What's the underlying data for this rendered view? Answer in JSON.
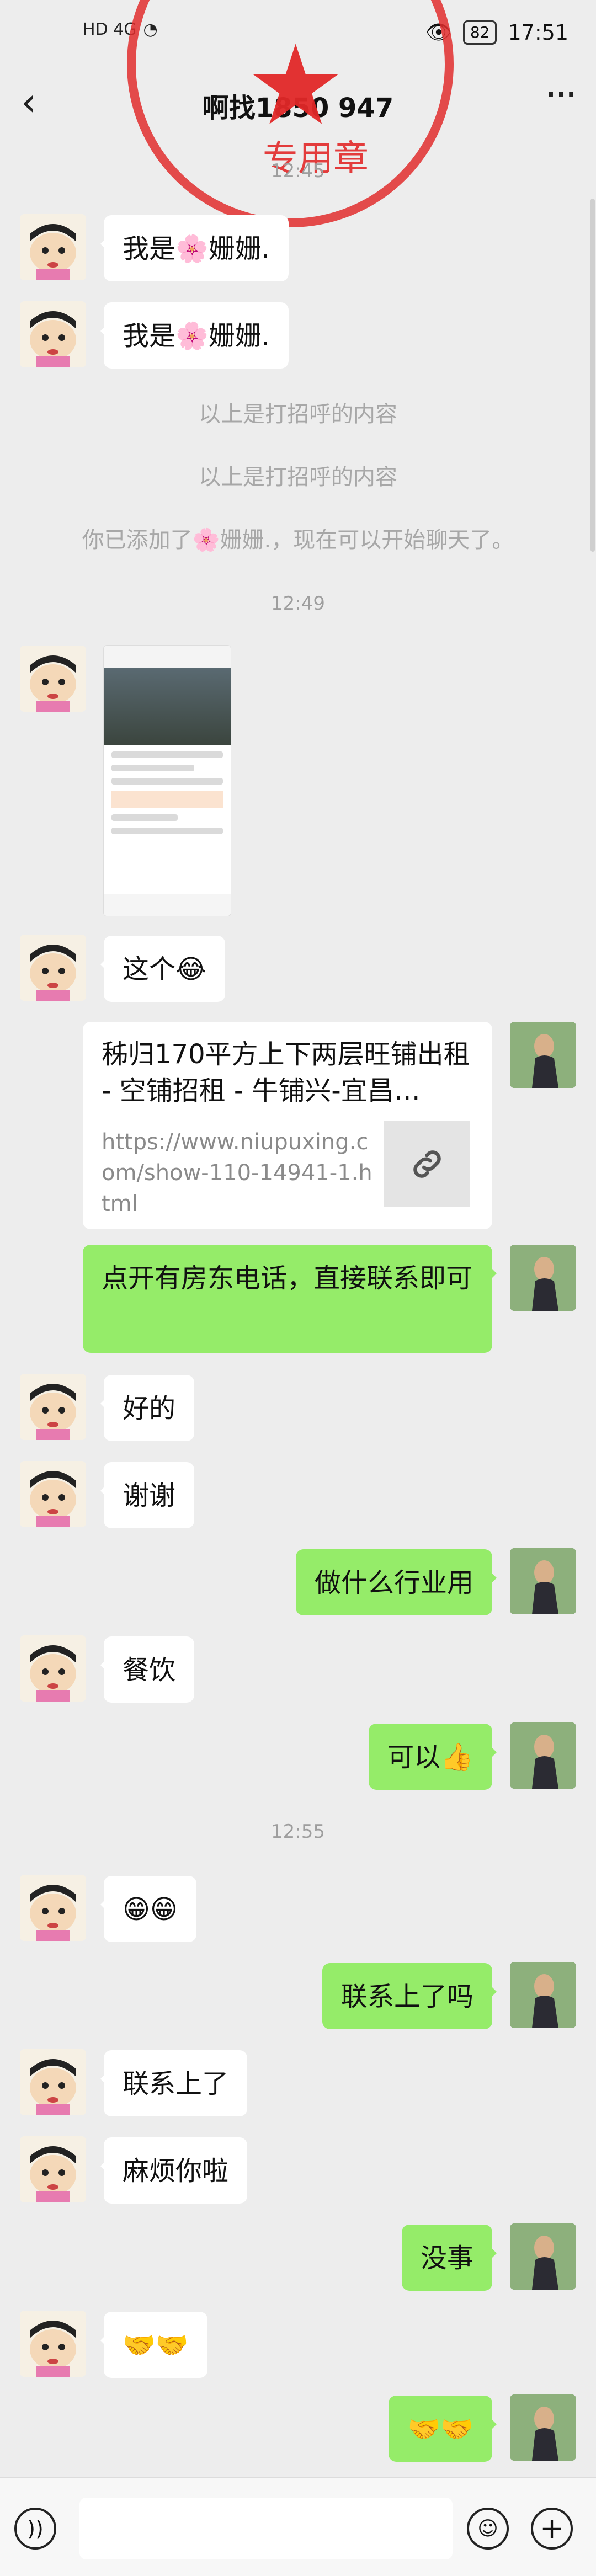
{
  "status_bar": {
    "signal_left": "HD 4G",
    "battery": "82",
    "time": "17:51"
  },
  "header": {
    "back_icon": "chevron-left-icon",
    "title": "啊找1850   947",
    "more_icon": "more-dots-icon"
  },
  "stamp": {
    "label": "专用章"
  },
  "conversation": {
    "timestamps": [
      "12:45",
      "12:49",
      "12:55"
    ],
    "notices": [
      "以上是打招呼的内容",
      "以上是打招呼的内容",
      "你已添加了🌸姗姗.，现在可以开始聊天了。"
    ],
    "messages": {
      "m1": "我是🌸姗姗.",
      "m2": "我是🌸姗姗.",
      "m3": "这个😂",
      "m5": "点开有房东电话，直接联系即可",
      "m6": "好的",
      "m7": "谢谢",
      "m8": "做什么行业用",
      "m9": "餐饮",
      "m10": "可以👍",
      "m11": "😁😁",
      "m12": "联系上了吗",
      "m13": "联系上了",
      "m14": "麻烦你啦",
      "m15": "没事",
      "m16": "🤝🤝",
      "m17": "🤝🤝"
    },
    "link_card": {
      "title": "秭归170平方上下两层旺铺出租 - 空铺招租 - 牛铺兴-宜昌…",
      "url": "https://www.niupuxing.com/show-110-14941-1.html"
    }
  }
}
